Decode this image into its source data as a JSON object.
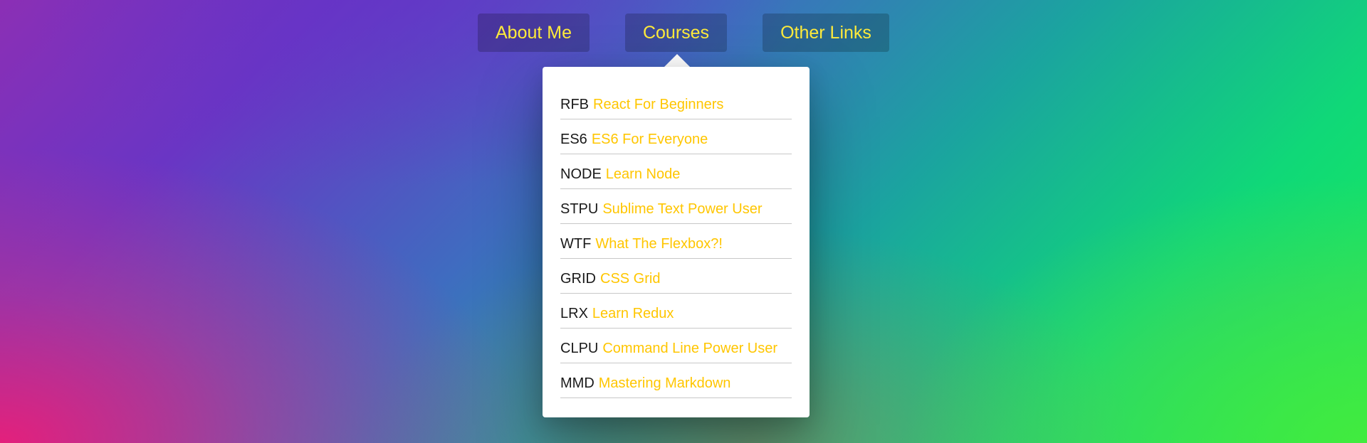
{
  "nav": {
    "about_label": "About Me",
    "courses_label": "Courses",
    "other_label": "Other Links"
  },
  "courses": [
    {
      "code": "RFB",
      "title": "React For Beginners"
    },
    {
      "code": "ES6",
      "title": "ES6 For Everyone"
    },
    {
      "code": "NODE",
      "title": "Learn Node"
    },
    {
      "code": "STPU",
      "title": "Sublime Text Power User"
    },
    {
      "code": "WTF",
      "title": "What The Flexbox?!"
    },
    {
      "code": "GRID",
      "title": "CSS Grid"
    },
    {
      "code": "LRX",
      "title": "Learn Redux"
    },
    {
      "code": "CLPU",
      "title": "Command Line Power User"
    },
    {
      "code": "MMD",
      "title": "Mastering Markdown"
    }
  ],
  "colors": {
    "nav_text": "#ffeb3b",
    "link_text": "#ffc600",
    "code_text": "#1a1a1a",
    "dropdown_bg": "#ffffff",
    "divider": "#c8c8c8"
  }
}
